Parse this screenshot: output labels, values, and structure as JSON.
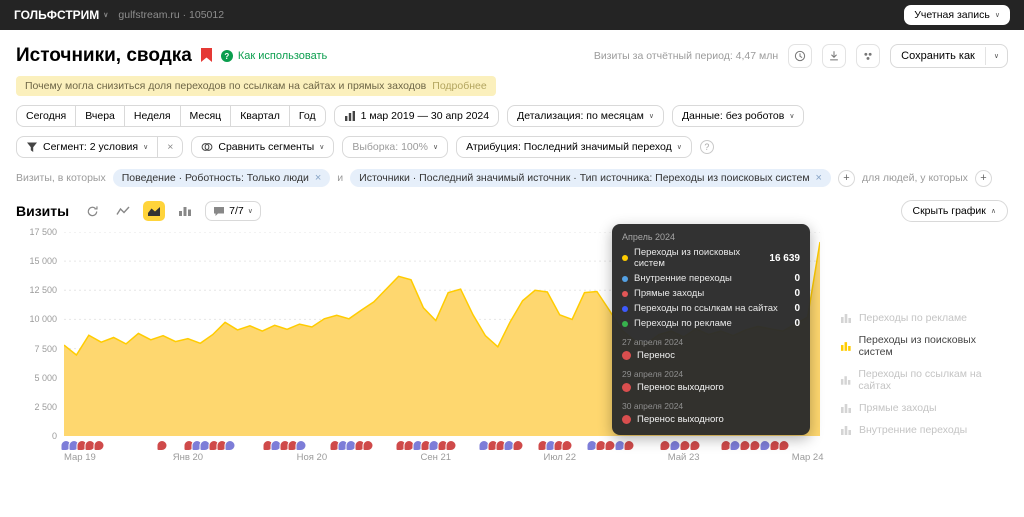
{
  "colors": {
    "accent_yellow": "#ffcc00",
    "area_fill": "#fed76f",
    "notice_bg": "#fbf0bd",
    "green_link": "#0b9e4e",
    "chip_bg": "#e6effa",
    "tooltip_bg": "#2b2b2b",
    "marker_red": "#cf4a4a",
    "marker_blue": "#7d7dd8"
  },
  "topbar": {
    "counter_name": "ГОЛЬФСТРИМ",
    "counter_info": "gulfstream.ru · 105012",
    "account_button": "Учетная запись"
  },
  "header": {
    "title": "Источники, сводка",
    "how_to_use": "Как использовать",
    "visits_summary": "Визиты за отчётный период: 4,47 млн",
    "save_as": "Сохранить как"
  },
  "notice": {
    "text": "Почему могла снизиться доля переходов по ссылкам на сайтах и прямых заходов",
    "link": "Подробнее"
  },
  "toolbar": {
    "date_buttons": [
      "Сегодня",
      "Вчера",
      "Неделя",
      "Месяц",
      "Квартал",
      "Год"
    ],
    "date_range": "1 мар 2019 — 30 апр 2024",
    "detalization": "Детализация: по месяцам",
    "data_mode": "Данные: без роботов",
    "segment": "Сегмент: 2 условия",
    "segment_clear": "×",
    "compare": "Сравнить сегменты",
    "sampling": "Выборка: 100%",
    "attribution": "Атрибуция: Последний значимый переход"
  },
  "filters": {
    "visits_label": "Визиты, в которых",
    "chip1": "Поведение · Роботность: Только люди",
    "and_label": "и",
    "chip2": "Источники · Последний значимый источник · Тип источника: Переходы из поисковых систем",
    "people_label": "для людей, у которых",
    "plus": "+"
  },
  "chart_header": {
    "title": "Визиты",
    "comments": "7/7",
    "hide_chart": "Скрыть график"
  },
  "chart_data": {
    "type": "area",
    "title": "Визиты",
    "series_name": "Переходы из поисковых систем",
    "x": [
      "2019-03",
      "2019-04",
      "2019-05",
      "2019-06",
      "2019-07",
      "2019-08",
      "2019-09",
      "2019-10",
      "2019-11",
      "2019-12",
      "2020-01",
      "2020-02",
      "2020-03",
      "2020-04",
      "2020-05",
      "2020-06",
      "2020-07",
      "2020-08",
      "2020-09",
      "2020-10",
      "2020-11",
      "2020-12",
      "2021-01",
      "2021-02",
      "2021-03",
      "2021-04",
      "2021-05",
      "2021-06",
      "2021-07",
      "2021-08",
      "2021-09",
      "2021-10",
      "2021-11",
      "2021-12",
      "2022-01",
      "2022-02",
      "2022-03",
      "2022-04",
      "2022-05",
      "2022-06",
      "2022-07",
      "2022-08",
      "2022-09",
      "2022-10",
      "2022-11",
      "2022-12",
      "2023-01",
      "2023-02",
      "2023-03",
      "2023-04",
      "2023-05",
      "2023-06",
      "2023-07",
      "2023-08",
      "2023-09",
      "2023-10",
      "2023-11",
      "2023-12",
      "2024-01",
      "2024-02",
      "2024-03",
      "2024-04"
    ],
    "values": [
      7800,
      6950,
      8650,
      8050,
      8450,
      7900,
      8800,
      8250,
      8600,
      8100,
      8350,
      7950,
      8700,
      9750,
      9100,
      9450,
      9000,
      9500,
      9150,
      9600,
      9350,
      10050,
      10350,
      10050,
      10800,
      11500,
      12600,
      13700,
      13400,
      11000,
      9900,
      12300,
      12600,
      10400,
      8600,
      7650,
      9800,
      11600,
      12500,
      12350,
      10400,
      10000,
      12300,
      12400,
      10800,
      9100,
      8200,
      7900,
      8700,
      9000,
      8500,
      9200,
      8700,
      9000,
      8600,
      9100,
      9400,
      9200,
      9000,
      9600,
      10200,
      16639
    ],
    "ylim": [
      0,
      17500
    ],
    "y_ticks": [
      "0",
      "2 500",
      "5 000",
      "7 500",
      "10 000",
      "12 500",
      "15 000",
      "17 500"
    ],
    "x_ticks": [
      {
        "label": "Мар 19",
        "index": 0
      },
      {
        "label": "Янв 20",
        "index": 10
      },
      {
        "label": "Ноя 20",
        "index": 20
      },
      {
        "label": "Сен 21",
        "index": 30
      },
      {
        "label": "Июл 22",
        "index": 40
      },
      {
        "label": "Май 23",
        "index": 50
      },
      {
        "label": "Мар 24",
        "index": 60
      }
    ],
    "grid": true,
    "legend_position": "right"
  },
  "tooltip": {
    "title": "Апрель 2024",
    "series": [
      {
        "label": "Переходы из поисковых систем",
        "value": "16 639",
        "color": "#ffcc00"
      },
      {
        "label": "Внутренние переходы",
        "value": "0",
        "color": "#54a1e4"
      },
      {
        "label": "Прямые заходы",
        "value": "0",
        "color": "#e25656"
      },
      {
        "label": "Переходы по ссылкам на сайтах",
        "value": "0",
        "color": "#3d5afe"
      },
      {
        "label": "Переходы по рекламе",
        "value": "0",
        "color": "#37b24d"
      }
    ],
    "notes": [
      {
        "date": "27 апреля 2024",
        "text": "Перенос"
      },
      {
        "date": "29 апреля 2024",
        "text": "Перенос выходного"
      },
      {
        "date": "30 апреля 2024",
        "text": "Перенос выходного"
      }
    ]
  },
  "legend": {
    "items": [
      {
        "label": "Переходы по рекламе",
        "active": false
      },
      {
        "label": "Переходы из поисковых систем",
        "active": true
      },
      {
        "label": "Переходы по ссылкам на сайтах",
        "active": false
      },
      {
        "label": "Прямые заходы",
        "active": false
      },
      {
        "label": "Внутренние переходы",
        "active": false
      }
    ]
  },
  "markers": [
    {
      "x": 0.3,
      "color": "blue"
    },
    {
      "x": 1.3,
      "color": "blue"
    },
    {
      "x": 2.4,
      "color": "red"
    },
    {
      "x": 3.5,
      "color": "red"
    },
    {
      "x": 4.6,
      "color": "red"
    },
    {
      "x": 13.0,
      "color": "red"
    },
    {
      "x": 16.5,
      "color": "red"
    },
    {
      "x": 17.6,
      "color": "blue"
    },
    {
      "x": 18.7,
      "color": "blue"
    },
    {
      "x": 19.8,
      "color": "red"
    },
    {
      "x": 20.9,
      "color": "red"
    },
    {
      "x": 22.0,
      "color": "blue"
    },
    {
      "x": 27.0,
      "color": "red"
    },
    {
      "x": 28.1,
      "color": "blue"
    },
    {
      "x": 29.2,
      "color": "red"
    },
    {
      "x": 30.3,
      "color": "red"
    },
    {
      "x": 31.4,
      "color": "blue"
    },
    {
      "x": 35.8,
      "color": "red"
    },
    {
      "x": 36.9,
      "color": "blue"
    },
    {
      "x": 38.0,
      "color": "blue"
    },
    {
      "x": 39.1,
      "color": "red"
    },
    {
      "x": 40.2,
      "color": "red"
    },
    {
      "x": 44.6,
      "color": "red"
    },
    {
      "x": 45.7,
      "color": "red"
    },
    {
      "x": 46.8,
      "color": "blue"
    },
    {
      "x": 47.9,
      "color": "red"
    },
    {
      "x": 49.0,
      "color": "blue"
    },
    {
      "x": 50.1,
      "color": "red"
    },
    {
      "x": 51.2,
      "color": "red"
    },
    {
      "x": 55.6,
      "color": "blue"
    },
    {
      "x": 56.7,
      "color": "red"
    },
    {
      "x": 57.8,
      "color": "red"
    },
    {
      "x": 58.9,
      "color": "blue"
    },
    {
      "x": 60.0,
      "color": "red"
    },
    {
      "x": 63.3,
      "color": "red"
    },
    {
      "x": 64.4,
      "color": "blue"
    },
    {
      "x": 65.5,
      "color": "red"
    },
    {
      "x": 66.6,
      "color": "red"
    },
    {
      "x": 69.9,
      "color": "blue"
    },
    {
      "x": 71.0,
      "color": "red"
    },
    {
      "x": 72.2,
      "color": "red"
    },
    {
      "x": 73.5,
      "color": "blue"
    },
    {
      "x": 74.8,
      "color": "red"
    },
    {
      "x": 79.5,
      "color": "red"
    },
    {
      "x": 80.8,
      "color": "blue"
    },
    {
      "x": 82.1,
      "color": "red"
    },
    {
      "x": 83.4,
      "color": "red"
    },
    {
      "x": 87.5,
      "color": "red"
    },
    {
      "x": 88.8,
      "color": "blue"
    },
    {
      "x": 90.1,
      "color": "red"
    },
    {
      "x": 91.4,
      "color": "red"
    },
    {
      "x": 92.7,
      "color": "blue"
    },
    {
      "x": 94.0,
      "color": "red"
    },
    {
      "x": 95.3,
      "color": "red"
    }
  ]
}
